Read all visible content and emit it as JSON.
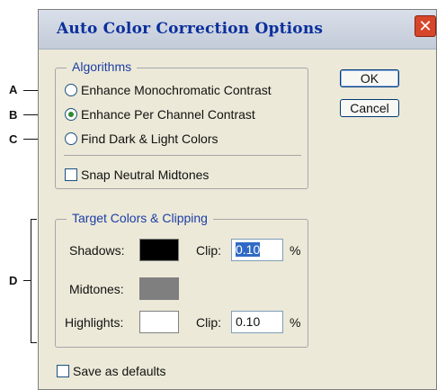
{
  "callouts": {
    "a": "A",
    "b": "B",
    "c": "C",
    "d": "D"
  },
  "dialog": {
    "title": "Auto Color Correction Options",
    "close_glyph": "✕"
  },
  "algorithms": {
    "legend": "Algorithms",
    "options": [
      {
        "label": "Enhance Monochromatic Contrast",
        "selected": false
      },
      {
        "label": "Enhance Per Channel Contrast",
        "selected": true
      },
      {
        "label": "Find Dark & Light Colors",
        "selected": false
      }
    ],
    "snap_label": "Snap Neutral Midtones",
    "snap_checked": false
  },
  "buttons": {
    "ok": "OK",
    "cancel": "Cancel"
  },
  "target": {
    "legend": "Target Colors & Clipping",
    "shadows_label": "Shadows:",
    "midtones_label": "Midtones:",
    "highlights_label": "Highlights:",
    "clip_label": "Clip:",
    "percent": "%",
    "shadows_clip": "0.10",
    "highlights_clip": "0.10",
    "shadows_color": "#000000",
    "midtones_color": "#7f7f7f",
    "highlights_color": "#ffffff"
  },
  "save_defaults_label": "Save as defaults",
  "save_defaults_checked": false
}
